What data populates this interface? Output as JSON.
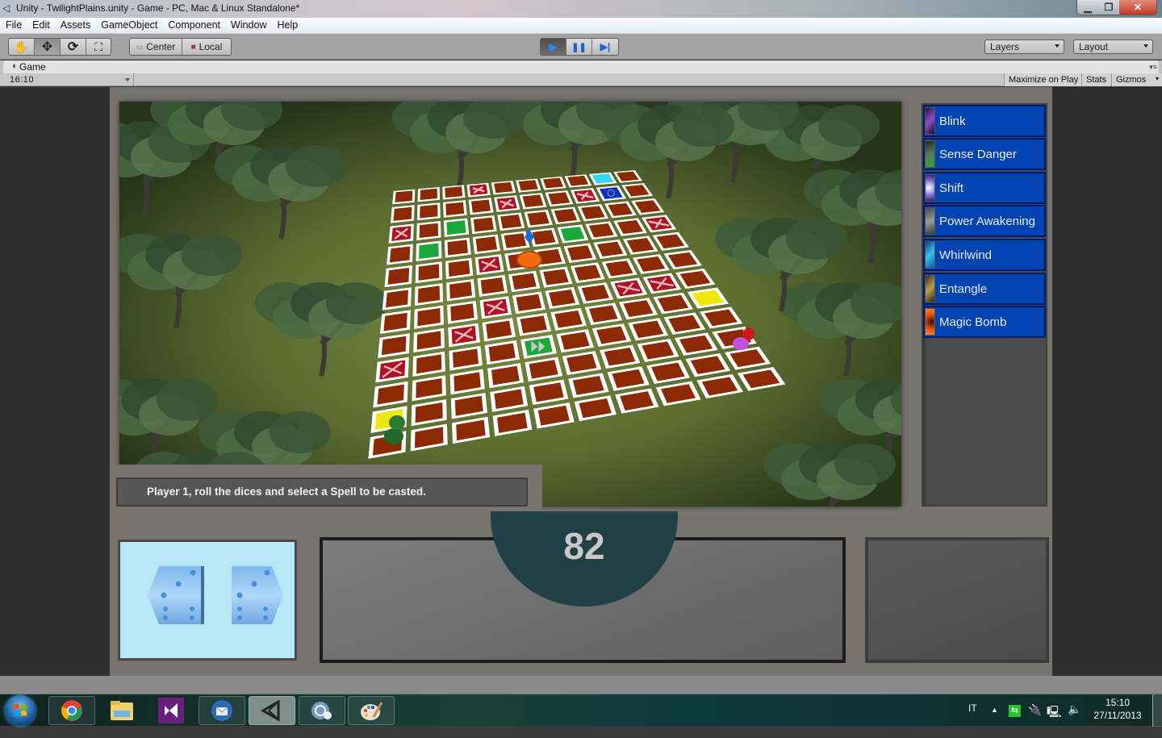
{
  "window": {
    "title": "Unity - TwilightPlains.unity - Game - PC, Mac & Linux Standalone*",
    "controls": {
      "minimize": "minimize",
      "maximize": "restore",
      "close": "close"
    }
  },
  "menu": [
    "File",
    "Edit",
    "Assets",
    "GameObject",
    "Component",
    "Window",
    "Help"
  ],
  "toolbar": {
    "transform_tools": [
      {
        "name": "hand-tool",
        "icon": "✋"
      },
      {
        "name": "move-tool",
        "icon": "✥"
      },
      {
        "name": "rotate-tool",
        "icon": "⟳"
      },
      {
        "name": "scale-tool",
        "icon": "⛶"
      }
    ],
    "pivot": {
      "center_label": "Center",
      "local_label": "Local"
    },
    "playback": {
      "play_icon": "▶",
      "pause_icon": "❚❚",
      "step_icon": "▶|"
    },
    "layers_label": "Layers",
    "layout_label": "Layout"
  },
  "game_tab": {
    "label": "Game",
    "aspect": "16:10",
    "maximize_label": "Maximize on Play",
    "stats_label": "Stats",
    "gizmos_label": "Gizmos"
  },
  "game": {
    "message": "Player 1, roll the dices and select a Spell to be casted.",
    "timer": "82",
    "spells": [
      {
        "label": "Blink",
        "icon_color": "#6b3fa0"
      },
      {
        "label": "Sense Danger",
        "icon_color": "#3b5b3a"
      },
      {
        "label": "Shift",
        "icon_color": "#8a7ad8"
      },
      {
        "label": "Power Awakening",
        "icon_color": "#6c6c6c"
      },
      {
        "label": "Whirlwind",
        "icon_color": "#2aa7e0"
      },
      {
        "label": "Entangle",
        "icon_color": "#8a7a3a"
      },
      {
        "label": "Magic Bomb",
        "icon_color": "#d24a12"
      }
    ],
    "dice": [
      {
        "faces_visible": [
          3,
          6
        ]
      },
      {
        "faces_visible": [
          3,
          6
        ]
      }
    ],
    "board": {
      "rows": 12,
      "cols": 10,
      "special_tiles": [
        {
          "row": 0,
          "col": 3,
          "type": "blocked"
        },
        {
          "row": 0,
          "col": 8,
          "type": "teleport"
        },
        {
          "row": 1,
          "col": 4,
          "type": "blocked"
        },
        {
          "row": 1,
          "col": 7,
          "type": "blocked"
        },
        {
          "row": 1,
          "col": 8,
          "type": "portal"
        },
        {
          "row": 2,
          "col": 0,
          "type": "blocked"
        },
        {
          "row": 2,
          "col": 2,
          "type": "arrow-down"
        },
        {
          "row": 3,
          "col": 1,
          "type": "arrow-down"
        },
        {
          "row": 3,
          "col": 6,
          "type": "arrow-up"
        },
        {
          "row": 3,
          "col": 9,
          "type": "blocked"
        },
        {
          "row": 4,
          "col": 3,
          "type": "blocked"
        },
        {
          "row": 6,
          "col": 3,
          "type": "blocked"
        },
        {
          "row": 6,
          "col": 7,
          "type": "blocked"
        },
        {
          "row": 6,
          "col": 8,
          "type": "blocked"
        },
        {
          "row": 7,
          "col": 2,
          "type": "blocked"
        },
        {
          "row": 8,
          "col": 0,
          "type": "blocked"
        },
        {
          "row": 8,
          "col": 4,
          "type": "fast-forward"
        },
        {
          "row": 10,
          "col": 0,
          "type": "start-yellow"
        },
        {
          "row": 7,
          "col": 9,
          "type": "start-yellow"
        }
      ],
      "tile_colors": {
        "normal": "#8b2a04",
        "blocked": "#b01020",
        "arrow": "#19a83a",
        "teleport": "#38d8e8",
        "portal": "#1030c0",
        "start": "#f0e610",
        "border": "#ffffff"
      }
    }
  },
  "taskbar": {
    "apps": [
      {
        "name": "chrome",
        "active": false
      },
      {
        "name": "file-explorer",
        "active": false
      },
      {
        "name": "visual-studio",
        "active": false
      },
      {
        "name": "thunderbird",
        "active": false
      },
      {
        "name": "unity",
        "active": true
      },
      {
        "name": "monodevelop",
        "active": false
      },
      {
        "name": "paint",
        "active": false
      }
    ],
    "language": "IT",
    "time": "15:10",
    "date": "27/11/2013"
  }
}
